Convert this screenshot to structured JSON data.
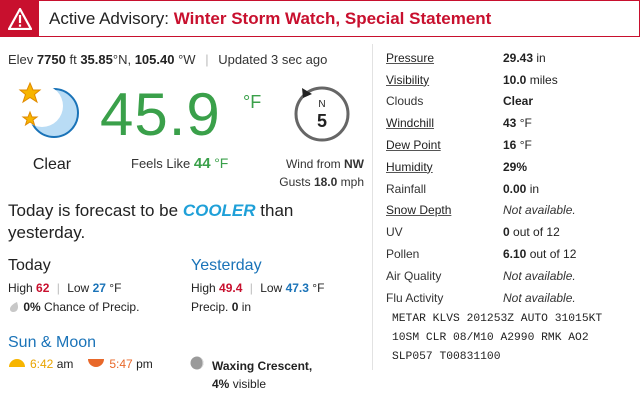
{
  "advisory": {
    "label": "Active Advisory:",
    "watch": "Winter Storm Watch",
    "comma": ",",
    "statement": "Special Statement"
  },
  "station": {
    "elev_label": "Elev",
    "elev_value": "7750",
    "elev_unit": "ft",
    "lat_value": "35.85",
    "lat_dir": "°N,",
    "lon_value": "105.40",
    "lon_dir": "°W",
    "updated_label": "Updated",
    "updated_value": "3 sec ago"
  },
  "current": {
    "condition": "Clear",
    "condition_icon": "moon-and-stars-icon",
    "temperature": "45.9",
    "unit": "°F",
    "feels_like_label": "Feels Like",
    "feels_like_value": "44",
    "feels_like_unit": "°F"
  },
  "wind": {
    "compass_dir": "N",
    "speed": "5",
    "from_label": "Wind from",
    "from_dir": "NW",
    "gusts_label": "Gusts",
    "gusts_value": "18.0",
    "gusts_unit": "mph"
  },
  "forecast": {
    "prefix": "Today is forecast to be",
    "trend": "COOLER",
    "suffix": "than yesterday."
  },
  "today": {
    "heading": "Today",
    "high_label": "High",
    "high": "62",
    "low_label": "Low",
    "low": "27",
    "unit": "°F",
    "precip_value": "0%",
    "precip_label": "Chance of Precip."
  },
  "yesterday": {
    "heading": "Yesterday",
    "high_label": "High",
    "high": "49.4",
    "low_label": "Low",
    "low": "47.3",
    "unit": "°F",
    "precip_label": "Precip.",
    "precip_value": "0",
    "precip_unit": "in"
  },
  "sun_moon": {
    "heading": "Sun & Moon",
    "sunrise": "6:42",
    "sunrise_unit": "am",
    "sunset": "5:47",
    "sunset_unit": "pm",
    "moon_phase": "Waxing Crescent,",
    "moon_visible": "4%",
    "moon_visible_label": "visible"
  },
  "metrics": [
    {
      "label": "Pressure",
      "value": "29.43",
      "unit": "in",
      "underline": true
    },
    {
      "label": "Visibility",
      "value": "10.0",
      "unit": "miles",
      "underline": true
    },
    {
      "label": "Clouds",
      "value": "Clear",
      "unit": "",
      "underline": false
    },
    {
      "label": "Windchill",
      "value": "43",
      "unit": "°F",
      "underline": true
    },
    {
      "label": "Dew Point",
      "value": "16",
      "unit": "°F",
      "underline": true
    },
    {
      "label": "Humidity",
      "value": "29%",
      "unit": "",
      "underline": true
    },
    {
      "label": "Rainfall",
      "value": "0.00",
      "unit": "in",
      "underline": false
    },
    {
      "label": "Snow Depth",
      "value": "Not available.",
      "unit": "",
      "underline": true,
      "na": true
    },
    {
      "label": "UV",
      "value": "0",
      "unit": "out of 12",
      "underline": false
    },
    {
      "label": "Pollen",
      "value": "6.10",
      "unit": "out of 12",
      "underline": false,
      "blue": true
    },
    {
      "label": "Air Quality",
      "value": "Not available.",
      "unit": "",
      "underline": false,
      "na": true
    },
    {
      "label": "Flu Activity",
      "value": "Not available.",
      "unit": "",
      "underline": false,
      "na": true
    }
  ],
  "metar": "METAR KLVS 201253Z AUTO 31015KT 10SM CLR 08/M10 A2990 RMK AO2 SLP057 T00831100",
  "colors": {
    "alert_red": "#c8102e",
    "temp_green": "#3aa04a",
    "link_blue": "#1a73b8",
    "cooler_blue": "#1fa0d8"
  }
}
